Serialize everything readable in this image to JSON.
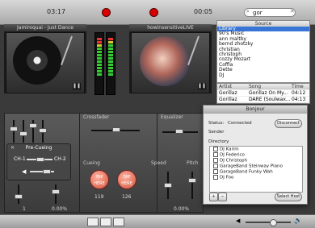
{
  "top": {
    "time_left": "03:17",
    "time_right": "00:05",
    "search_value": "gor"
  },
  "decks": {
    "left_title": "Jamiroquai - Just Dance",
    "right_title": "howinsensitiveLIVE"
  },
  "library": {
    "header": "Source",
    "items": [
      "Library",
      "90's Music",
      "ann maltby",
      "bernd zhotzky",
      "christian",
      "christoph",
      "cozzy Mozart",
      "Coffia",
      "Dette",
      "DJ"
    ],
    "selected_index": 0
  },
  "table": {
    "headers": [
      "Artist",
      "Song",
      "Time"
    ],
    "rows": [
      [
        "Gorillaz",
        "Gorillaz On My...",
        "04:12"
      ],
      [
        "Gorillaz",
        "DARE (Soulwax...",
        "04:13"
      ]
    ]
  },
  "panels": {
    "crossfader": "Crossfader",
    "equalizer": "Equalizer",
    "cueing": "Cueing",
    "speed": "Speed",
    "pitch": "Pitch",
    "tap_label": "TAP HERE",
    "bpm_left": "119",
    "bpm_right": "126",
    "zero_left": "0.00%",
    "zero_right": "0.00%"
  },
  "precue": {
    "title": "Pre-Cueing",
    "ch1": "CH-1",
    "ch2": "CH-2"
  },
  "bonjour": {
    "title": "Bonjour",
    "status_label": "Status:",
    "status_value": "Connected",
    "disconnect": "Disconnect",
    "sender_label": "Sender",
    "directory_label": "Directory",
    "directory": [
      "DJ Karim",
      "DJ Federico",
      "DJ Christoph",
      "GarageBand Steinway Piano",
      "GarageBand Funky Wah",
      "DJ Foo"
    ],
    "select_host": "Select Host"
  }
}
